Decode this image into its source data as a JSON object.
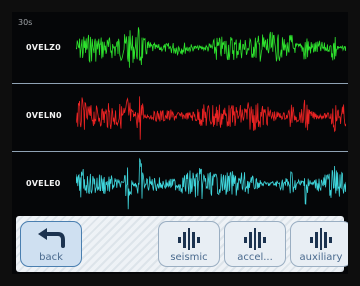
{
  "window": {
    "time_window": "30s"
  },
  "channels": [
    {
      "label": "0VELZ0",
      "color": "#2ee22e"
    },
    {
      "label": "0VELN0",
      "color": "#ec2323"
    },
    {
      "label": "0VELE0",
      "color": "#3fd6dc"
    }
  ],
  "toolbar": {
    "back_label": "back",
    "modes": [
      {
        "label": "seismic",
        "icon": "waveform-icon"
      },
      {
        "label": "accel...",
        "icon": "waveform-icon"
      },
      {
        "label": "auxiliary",
        "icon": "waveform-icon"
      }
    ],
    "back_icon": "undo-arrow-icon"
  },
  "colors": {
    "accent": "#4a7fb0",
    "separator": "#8fa2b4",
    "background": "#050608"
  }
}
